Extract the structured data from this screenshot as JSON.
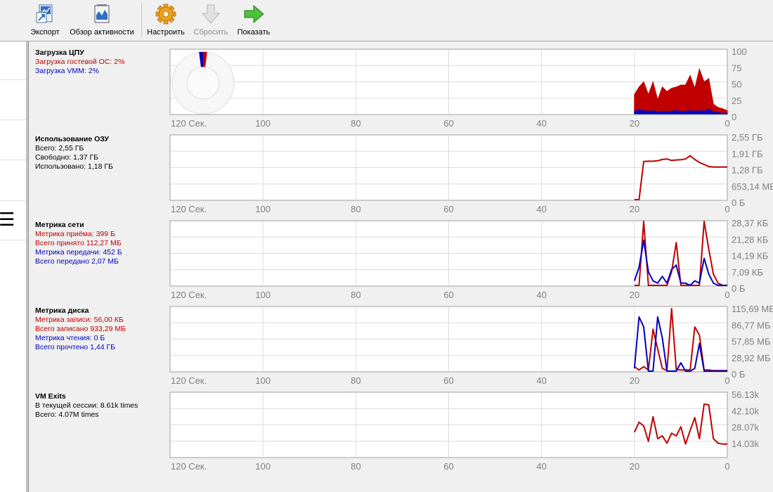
{
  "toolbar": {
    "items": [
      {
        "label": "Экспорт",
        "icon": "export-icon",
        "enabled": true
      },
      {
        "label": "Обзор активности",
        "icon": "activity-overview-icon",
        "enabled": true
      },
      {
        "label": "Настроить",
        "icon": "settings-gear-icon",
        "enabled": true
      },
      {
        "label": "Сбросить",
        "icon": "reset-down-arrow-icon",
        "enabled": false
      },
      {
        "label": "Показать",
        "icon": "show-right-arrow-icon",
        "enabled": true
      }
    ]
  },
  "left_panel": {
    "menu_icon": "☰"
  },
  "colors": {
    "guest": "#c00000",
    "vmm": "#0000c0",
    "grid": "#dcdcdc",
    "frame": "#a0a0a0"
  },
  "time_axis": {
    "labels": [
      "120 Сек.",
      "100",
      "80",
      "60",
      "40",
      "20",
      "0"
    ]
  },
  "panels": {
    "cpu": {
      "title": "Загрузка ЦПУ",
      "lines": [
        {
          "text": "Загрузка гостевой ОС: 2%",
          "color": "red"
        },
        {
          "text": "Загрузка VMM: 2%",
          "color": "blue"
        }
      ]
    },
    "ram": {
      "title": "Использование ОЗУ",
      "lines": [
        {
          "text": "Всего: 2,55 ГБ",
          "color": "black"
        },
        {
          "text": "Свободно: 1,37 ГБ",
          "color": "black"
        },
        {
          "text": "Использовано: 1,18 ГБ",
          "color": "black"
        }
      ]
    },
    "net": {
      "title": "Метрика сети",
      "lines": [
        {
          "text": "Метрика приёма: 399 Б",
          "color": "red"
        },
        {
          "text": "Всего принято 112,27 МБ",
          "color": "red"
        },
        {
          "text": "Метрика передачи: 452 Б",
          "color": "blue"
        },
        {
          "text": "Всего передано 2,07 МБ",
          "color": "blue"
        }
      ]
    },
    "disk": {
      "title": "Метрика диска",
      "lines": [
        {
          "text": "Метрика записи: 56,00 КБ",
          "color": "red"
        },
        {
          "text": "Всего записано 933,29 МБ",
          "color": "red"
        },
        {
          "text": "Метрика чтения: 0 Б",
          "color": "blue"
        },
        {
          "text": "Всего прочтено 1,44 ГБ",
          "color": "blue"
        }
      ]
    },
    "exits": {
      "title": "VM Exits",
      "lines": [
        {
          "text": "В текущей сессии: 8.61k times",
          "color": "black"
        },
        {
          "text": "Всего: 4.07M times",
          "color": "black"
        }
      ]
    }
  },
  "chart_data": [
    {
      "id": "cpu",
      "type": "area",
      "xlabel": "",
      "x_ticks": [
        "120 Сек.",
        "100",
        "80",
        "60",
        "40",
        "20",
        "0"
      ],
      "y_ticks": [
        "100",
        "75",
        "50",
        "25",
        "0"
      ],
      "ylim": [
        0,
        100
      ],
      "pie": {
        "guest": 2,
        "vmm": 2
      },
      "series": [
        {
          "name": "Загрузка гостевой ОС",
          "color": "#c00000",
          "fill": true,
          "x": [
            20,
            19,
            18,
            17,
            16,
            15,
            14,
            13,
            12,
            11,
            10,
            9,
            8,
            7,
            6,
            5,
            4,
            3,
            2,
            1,
            0
          ],
          "y": [
            30,
            42,
            50,
            30,
            50,
            22,
            42,
            35,
            40,
            42,
            45,
            45,
            60,
            40,
            70,
            50,
            55,
            15,
            10,
            8,
            5
          ]
        },
        {
          "name": "Загрузка VMM",
          "color": "#0000c0",
          "fill": true,
          "x": [
            20,
            19,
            18,
            17,
            16,
            15,
            14,
            13,
            12,
            11,
            10,
            9,
            8,
            7,
            6,
            5,
            4,
            3,
            2,
            1,
            0
          ],
          "y": [
            4,
            6,
            5,
            4,
            5,
            3,
            4,
            4,
            4,
            5,
            4,
            4,
            5,
            4,
            5,
            4,
            7,
            3,
            2,
            1,
            1
          ]
        }
      ]
    },
    {
      "id": "ram",
      "type": "line",
      "x_ticks": [
        "120 Сек.",
        "100",
        "80",
        "60",
        "40",
        "20",
        "0"
      ],
      "y_ticks": [
        "2,55 ГБ",
        "1,91 ГБ",
        "1,28 ГБ",
        "653,14 МБ",
        "0 Б"
      ],
      "ylim": [
        0,
        2.55
      ],
      "series": [
        {
          "name": "Использовано",
          "color": "#c00000",
          "x": [
            20,
            19,
            18,
            17,
            16,
            15,
            14,
            13,
            12,
            11,
            10,
            9,
            8,
            7,
            6,
            5,
            4,
            3,
            2,
            1,
            0
          ],
          "y": [
            0,
            0,
            1.52,
            1.53,
            1.53,
            1.55,
            1.6,
            1.62,
            1.56,
            1.58,
            1.59,
            1.62,
            1.75,
            1.6,
            1.48,
            1.4,
            1.32,
            1.3,
            1.3,
            1.3,
            1.3
          ]
        }
      ]
    },
    {
      "id": "net",
      "type": "line",
      "x_ticks": [
        "120 Сек.",
        "100",
        "80",
        "60",
        "40",
        "20",
        "0"
      ],
      "y_ticks": [
        "28,37 КБ",
        "21,28 КБ",
        "14,19 КБ",
        "7,09 КБ",
        "0 Б"
      ],
      "ylim": [
        0,
        28.37
      ],
      "series": [
        {
          "name": "Метрика приёма",
          "color": "#c00000",
          "x": [
            20,
            19,
            18,
            17,
            16,
            15,
            14,
            13,
            12,
            11,
            10,
            9,
            8,
            7,
            6,
            5,
            4,
            3,
            2,
            1,
            0
          ],
          "y": [
            0,
            0,
            28.37,
            0,
            0,
            0,
            0,
            0,
            6,
            19,
            0,
            0,
            0,
            0,
            0,
            28.37,
            16,
            5,
            1,
            0,
            0
          ]
        },
        {
          "name": "Метрика передачи",
          "color": "#0000c0",
          "x": [
            20,
            19,
            18,
            17,
            16,
            15,
            14,
            13,
            12,
            11,
            10,
            9,
            8,
            7,
            6,
            5,
            4,
            3,
            2,
            1,
            0
          ],
          "y": [
            2,
            8,
            20,
            6,
            2,
            1,
            4,
            1,
            7,
            9,
            1,
            1,
            0,
            2,
            1,
            12,
            5,
            1,
            0,
            0,
            0
          ]
        }
      ]
    },
    {
      "id": "disk",
      "type": "line",
      "x_ticks": [
        "120 Сек.",
        "100",
        "80",
        "60",
        "40",
        "20",
        "0"
      ],
      "y_ticks": [
        "115,69 МБ",
        "86,77 МБ",
        "57,85 МБ",
        "28,92 МБ",
        "0 Б"
      ],
      "ylim": [
        0,
        115.69
      ],
      "series": [
        {
          "name": "Метрика записи",
          "color": "#c00000",
          "x": [
            20,
            19,
            18,
            17,
            16,
            15,
            14,
            13,
            12,
            11,
            10,
            9,
            8,
            7,
            6,
            5,
            4,
            3,
            2,
            1,
            0
          ],
          "y": [
            8,
            2,
            8,
            2,
            76,
            40,
            5,
            1,
            113,
            3,
            2,
            2,
            2,
            80,
            65,
            2,
            2,
            1,
            1,
            1,
            1
          ]
        },
        {
          "name": "Метрика чтения",
          "color": "#0000c0",
          "x": [
            20,
            19,
            18,
            17,
            16,
            15,
            14,
            13,
            12,
            11,
            10,
            9,
            8,
            7,
            6,
            5,
            4,
            3,
            2,
            1,
            0
          ],
          "y": [
            5,
            98,
            80,
            0,
            0,
            98,
            60,
            0,
            0,
            0,
            15,
            0,
            0,
            5,
            50,
            0,
            0,
            0,
            0,
            0,
            0
          ]
        }
      ]
    },
    {
      "id": "exits",
      "type": "line",
      "x_ticks": [
        "120 Сек.",
        "100",
        "80",
        "60",
        "40",
        "20",
        "0"
      ],
      "y_ticks": [
        "56.13k",
        "42.10k",
        "28.07k",
        "14.03k"
      ],
      "ylim": [
        0,
        70.16
      ],
      "series": [
        {
          "name": "VM Exits",
          "color": "#c00000",
          "x": [
            20,
            19,
            18,
            17,
            16,
            15,
            14,
            13,
            12,
            11,
            10,
            9,
            8,
            7,
            6,
            5,
            4,
            3,
            2,
            1,
            0
          ],
          "y": [
            27,
            38,
            34,
            17,
            44,
            20,
            23,
            15,
            26,
            23,
            33,
            14,
            29,
            43,
            20,
            58,
            57,
            20,
            15,
            14,
            14
          ]
        }
      ]
    }
  ]
}
